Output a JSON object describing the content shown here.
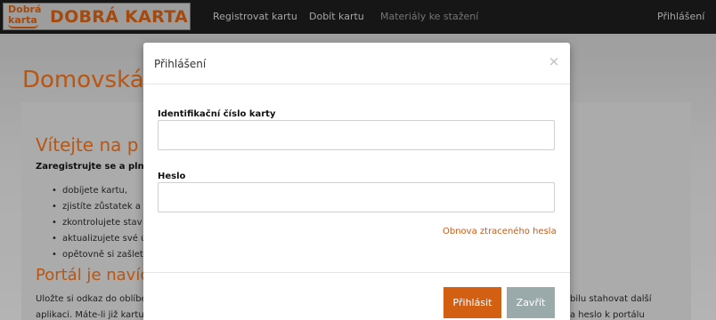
{
  "logo": {
    "small_line1": "Dobrá",
    "small_line2": "karta",
    "big_text": "DOBRÁ KARTA"
  },
  "nav": {
    "links": [
      "Registrovat kartu",
      "Dobít kartu",
      "Materiály ke stažení"
    ],
    "login": "Přihlášení"
  },
  "page": {
    "title": "Domovská",
    "welcome": "Vítejte na p",
    "register_line": "Zaregistrujte se a plně p",
    "bullets": [
      "dobíjete kartu,",
      "zjistíte zůstatek a p",
      "zkontrolujete stav",
      "aktualizujete své ú",
      "opětovně si zašlet"
    ],
    "portal_heading": "Portál je navíc",
    "para_line1": "Uložte si odkaz do oblíbe",
    "para_line2": "aplikaci. Máte-li již kartu",
    "para_line1_right": "bilu stahovat další",
    "para_line2_right": "a heslo k portálu"
  },
  "modal": {
    "title": "Přihlášení",
    "close_glyph": "×",
    "card_id_label": "Identifikační číslo karty",
    "card_id_value": "",
    "password_label": "Heslo",
    "password_value": "",
    "forgot_link": "Obnova ztraceného hesla",
    "login_button": "Přihlásit",
    "close_button": "Zavřít"
  },
  "colors": {
    "accent": "#c75b12",
    "primary_button": "#d35f12",
    "secondary_button": "#9aaaaa",
    "navbar": "#1c1c1c"
  }
}
